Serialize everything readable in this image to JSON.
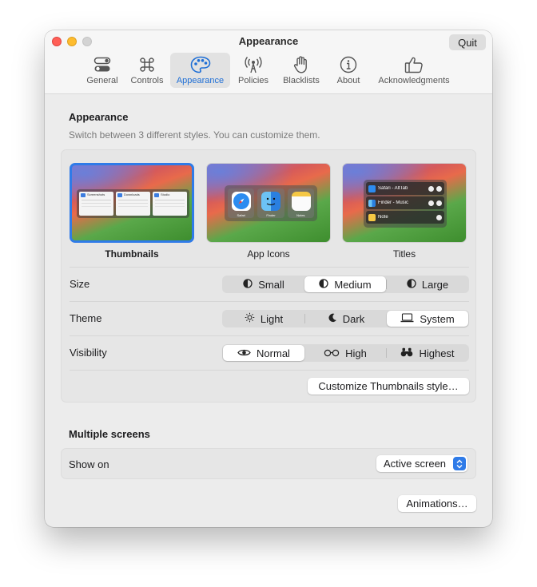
{
  "window": {
    "title": "Appearance",
    "quit_label": "Quit"
  },
  "tabs": [
    {
      "label": "General",
      "icon": "toggle-icon"
    },
    {
      "label": "Controls",
      "icon": "command-icon"
    },
    {
      "label": "Appearance",
      "icon": "palette-icon",
      "active": true
    },
    {
      "label": "Policies",
      "icon": "antenna-icon"
    },
    {
      "label": "Blacklists",
      "icon": "hand-icon"
    },
    {
      "label": "About",
      "icon": "info-icon"
    },
    {
      "label": "Acknowledgments",
      "icon": "thumbs-up-icon"
    }
  ],
  "appearance": {
    "title": "Appearance",
    "subtitle": "Switch between 3 different styles. You can customize them.",
    "styles": [
      {
        "label": "Thumbnails",
        "selected": true
      },
      {
        "label": "App Icons"
      },
      {
        "label": "Titles"
      }
    ],
    "thumbnail_preview": [
      "Screenshots",
      "Downloads",
      "Studio"
    ],
    "icon_preview": [
      "Safari",
      "Finder",
      "Notes"
    ],
    "titles_preview": [
      "Safari - AltTab",
      "Finder - Music",
      "Note"
    ],
    "size": {
      "label": "Size",
      "options": [
        "Small",
        "Medium",
        "Large"
      ],
      "selected": "Medium"
    },
    "theme": {
      "label": "Theme",
      "options": [
        "Light",
        "Dark",
        "System"
      ],
      "selected": "System"
    },
    "visibility": {
      "label": "Visibility",
      "options": [
        "Normal",
        "High",
        "Highest"
      ],
      "selected": "Normal"
    },
    "customize_label": "Customize Thumbnails style…"
  },
  "multiple_screens": {
    "title": "Multiple screens",
    "show_on_label": "Show on",
    "show_on_value": "Active screen"
  },
  "animations_label": "Animations…",
  "colors": {
    "accent": "#2f7be8",
    "active_tab_text": "#1f6fd6",
    "close": "#ff5f57",
    "minimize": "#febc2e"
  }
}
